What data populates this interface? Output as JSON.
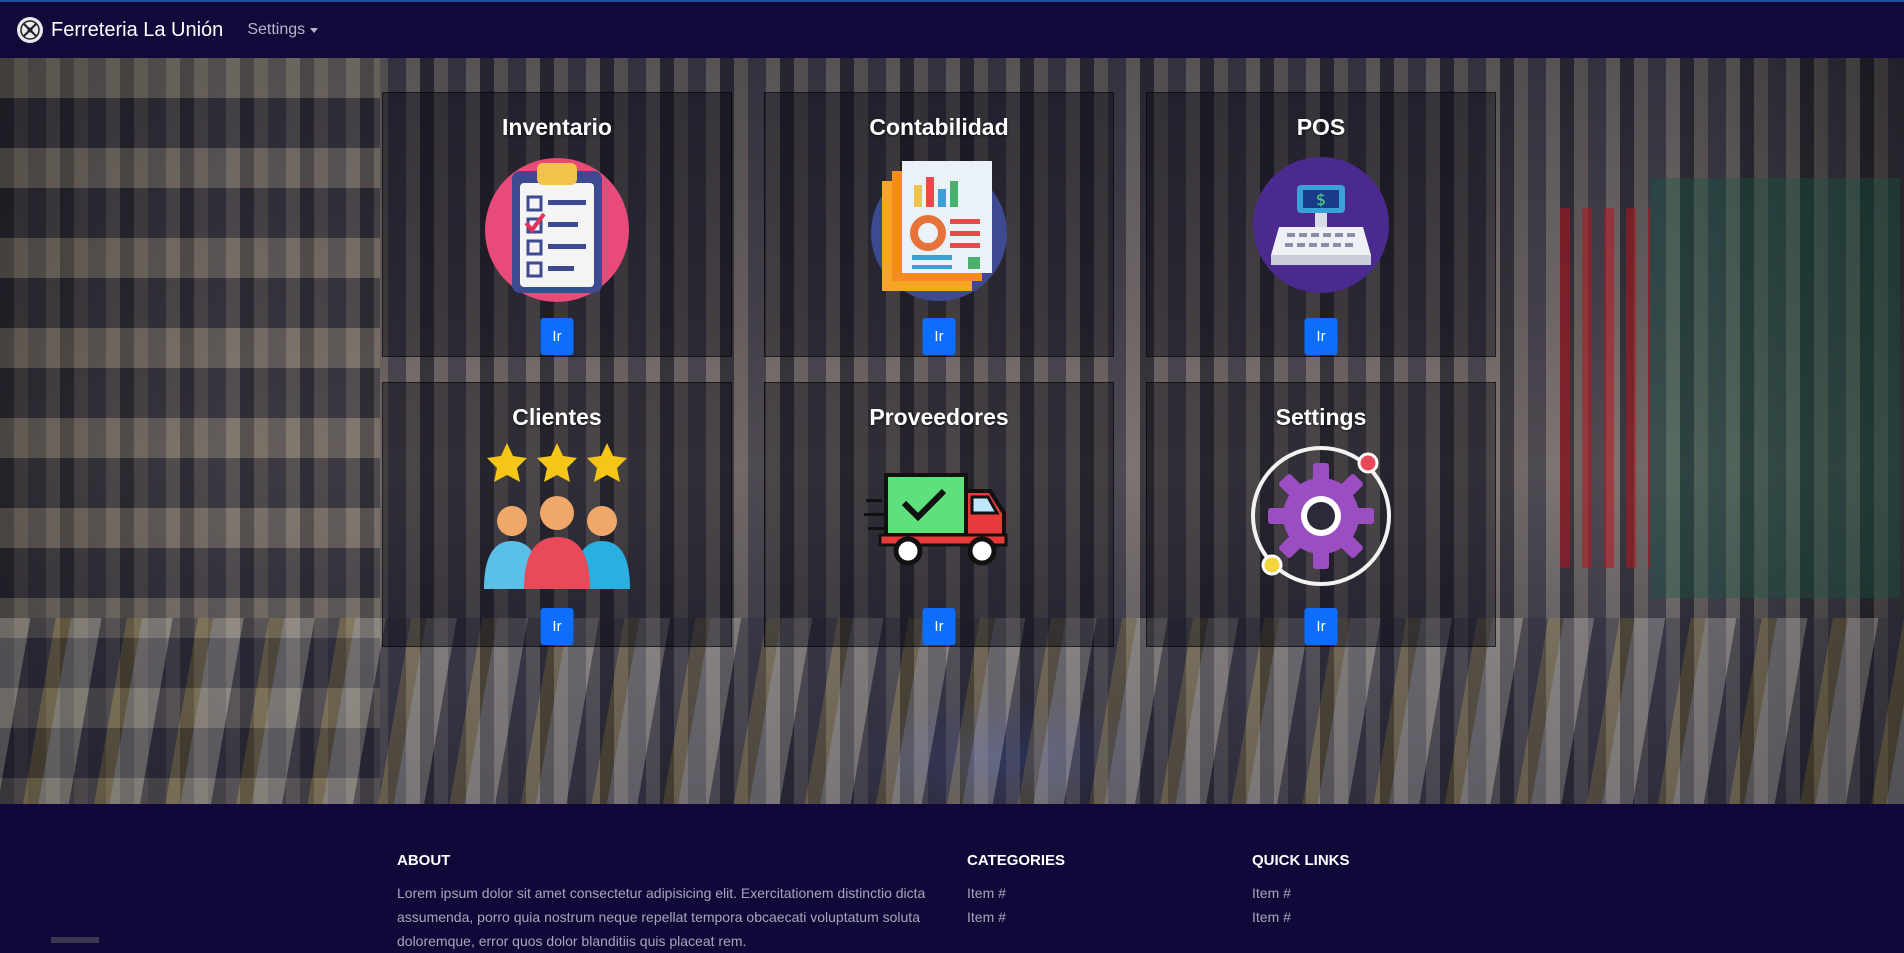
{
  "navbar": {
    "brand": "Ferreteria La Unión",
    "brand_icon": "compass-logo-icon",
    "dropdown": "Settings"
  },
  "modules": [
    {
      "title": "Inventario",
      "icon": "clipboard-checklist-icon",
      "button": "Ir"
    },
    {
      "title": "Contabilidad",
      "icon": "report-document-icon",
      "button": "Ir"
    },
    {
      "title": "POS",
      "icon": "cash-register-icon",
      "button": "Ir"
    },
    {
      "title": "Clientes",
      "icon": "customers-rating-icon",
      "button": "Ir"
    },
    {
      "title": "Proveedores",
      "icon": "delivery-truck-icon",
      "button": "Ir"
    },
    {
      "title": "Settings",
      "icon": "gear-icon",
      "button": "Ir"
    }
  ],
  "footer": {
    "about": {
      "heading": "ABOUT",
      "text": "Lorem ipsum dolor sit amet consectetur adipisicing elit. Exercitationem distinctio dicta assumenda, porro quia nostrum neque repellat tempora obcaecati voluptatum soluta doloremque, error quos dolor blanditiis quis placeat rem."
    },
    "categories": {
      "heading": "CATEGORIES",
      "items": [
        "Item #",
        "Item #"
      ]
    },
    "quick_links": {
      "heading": "QUICK LINKS",
      "items": [
        "Item #",
        "Item #"
      ]
    }
  },
  "colors": {
    "navbar": "#12083a",
    "footer": "#110739",
    "button": "#0d6efd"
  }
}
